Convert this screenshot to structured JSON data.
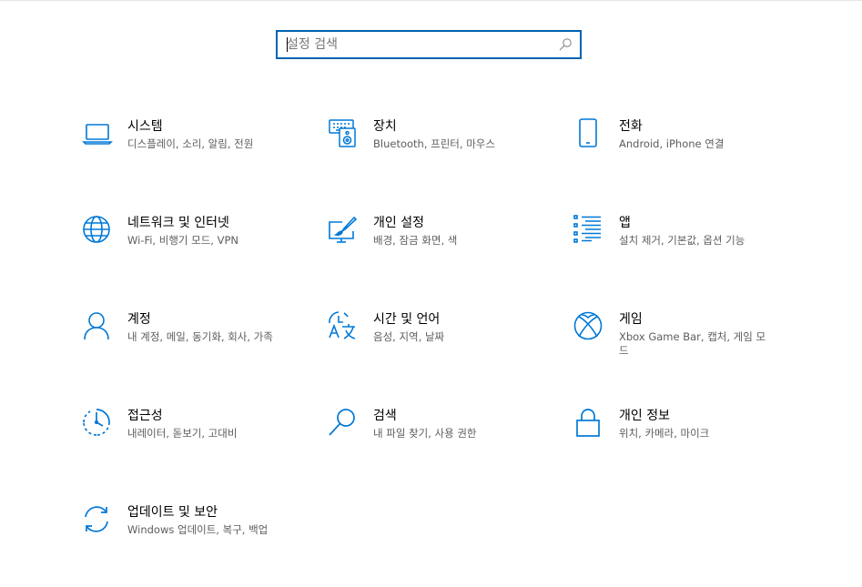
{
  "search": {
    "placeholder": "설정 검색"
  },
  "accent_color": "#0078d7",
  "tiles": [
    {
      "icon": "laptop-icon",
      "title": "시스템",
      "desc": "디스플레이, 소리, 알림, 전원"
    },
    {
      "icon": "keyboard-speaker-icon",
      "title": "장치",
      "desc": "Bluetooth, 프린터, 마우스"
    },
    {
      "icon": "phone-icon",
      "title": "전화",
      "desc": "Android, iPhone 연결"
    },
    {
      "icon": "globe-icon",
      "title": "네트워크 및 인터넷",
      "desc": "Wi-Fi, 비행기 모드, VPN"
    },
    {
      "icon": "paint-brush-icon",
      "title": "개인 설정",
      "desc": "배경, 잠금 화면, 색"
    },
    {
      "icon": "apps-list-icon",
      "title": "앱",
      "desc": "설치 제거, 기본값, 옵션 기능"
    },
    {
      "icon": "person-icon",
      "title": "계정",
      "desc": "내 계정, 메일, 동기화, 회사, 가족"
    },
    {
      "icon": "language-icon",
      "title": "시간 및 언어",
      "desc": "음성, 지역, 날짜"
    },
    {
      "icon": "xbox-icon",
      "title": "게임",
      "desc": "Xbox Game Bar, 캡처, 게임 모드"
    },
    {
      "icon": "ease-of-access-icon",
      "title": "접근성",
      "desc": "내레이터, 돋보기, 고대비"
    },
    {
      "icon": "search-icon",
      "title": "검색",
      "desc": "내 파일 찾기, 사용 권한"
    },
    {
      "icon": "lock-icon",
      "title": "개인 정보",
      "desc": "위치, 카메라, 마이크"
    },
    {
      "icon": "sync-icon",
      "title": "업데이트 및 보안",
      "desc": "Windows 업데이트, 복구, 백업"
    }
  ]
}
